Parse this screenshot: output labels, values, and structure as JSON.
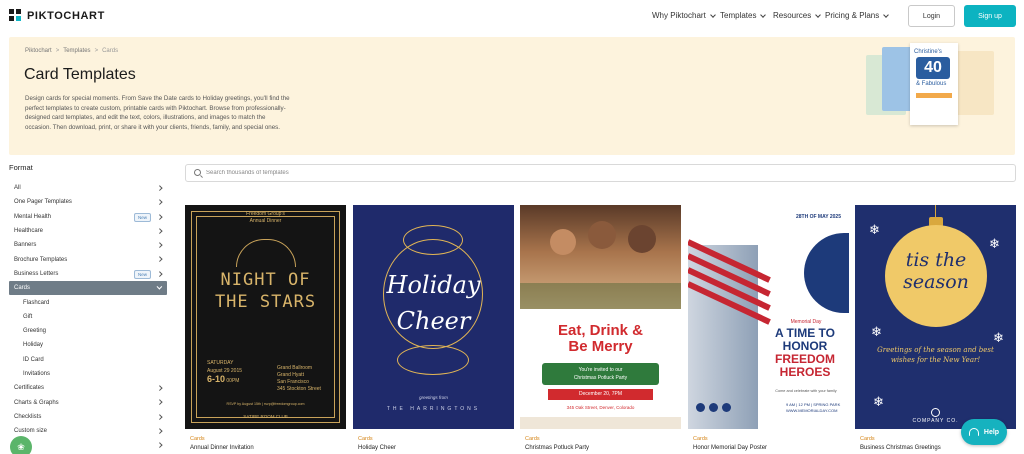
{
  "header": {
    "logo": "PIKTOCHART",
    "nav": [
      "Why Piktochart",
      "Templates",
      "Resources",
      "Pricing & Plans"
    ],
    "login": "Login",
    "signup": "Sign up"
  },
  "hero": {
    "breadcrumb": [
      "Piktochart",
      "Templates",
      "Cards"
    ],
    "title": "Card Templates",
    "description": "Design cards for special moments. From Save the Date cards to Holiday greetings, you'll find the perfect templates to create custom, printable cards with Piktochart. Browse from professionally-designed card templates, and edit the text, colors, illustrations, and images to match the occasion. Then download, print, or share it with your clients, friends, family, and special ones.",
    "art": {
      "line1": "Christine's",
      "number": "40",
      "line2": "& Fabulous"
    }
  },
  "sidebar": {
    "label": "Format",
    "items": [
      {
        "label": "All",
        "chevron": true
      },
      {
        "label": "One Pager Templates",
        "chevron": true
      },
      {
        "label": "Mental Health",
        "chevron": true,
        "badge": "New"
      },
      {
        "label": "Healthcare",
        "chevron": true
      },
      {
        "label": "Banners",
        "chevron": true
      },
      {
        "label": "Brochure Templates",
        "chevron": true
      },
      {
        "label": "Business Letters",
        "chevron": true,
        "badge": "New"
      },
      {
        "label": "Cards",
        "chevron": true,
        "active": true
      },
      {
        "label": "Flashcard",
        "sub": true
      },
      {
        "label": "Gift",
        "sub": true
      },
      {
        "label": "Greeting",
        "sub": true
      },
      {
        "label": "Holiday",
        "sub": true
      },
      {
        "label": "ID Card",
        "sub": true
      },
      {
        "label": "Invitations",
        "sub": true
      },
      {
        "label": "Certificates",
        "chevron": true
      },
      {
        "label": "Charts & Graphs",
        "chevron": true
      },
      {
        "label": "Checklists",
        "chevron": true
      },
      {
        "label": "Custom size",
        "chevron": true
      },
      {
        "label": "...ms",
        "chevron": true
      }
    ]
  },
  "search": {
    "placeholder": "Search thousands of templates"
  },
  "cards": [
    {
      "category": "Cards",
      "title": "Annual Dinner Invitation",
      "art": {
        "head1": "Freedom Group's",
        "head2": "Annual Dinner",
        "main1": "NIGHT OF",
        "main2": "THE STARS",
        "day": "SATURDAY",
        "date": "August 29 2015",
        "time": "6-10",
        "pm": "00PM",
        "venue": "Grand Ballroom\nGrand Hyatt\nSan Francisco\n345 Stockton Street",
        "rsvp": "RSVP by August 15th | rsvp@freedomgroup.com",
        "foot": "SATIRE ROOM CLUB"
      }
    },
    {
      "category": "Cards",
      "title": "Holiday Cheer",
      "art": {
        "line1": "Holiday",
        "line2": "Cheer",
        "greet": "greetings from",
        "sig": "THE HARRINGTONS"
      }
    },
    {
      "category": "Cards",
      "title": "Christmas Potluck Party",
      "art": {
        "h1": "Eat, Drink &",
        "h2": "Be Merry",
        "invite": "You're invited to our\nChristmas Potluck Party",
        "date": "December 20, 7PM",
        "addr": "345 Oak Street, Denver, Colorado"
      }
    },
    {
      "category": "Cards",
      "title": "Honor Memorial Day Poster",
      "art": {
        "date": "28TH OF MAY 2025",
        "sub": "Memorial Day",
        "l1": "A TIME TO",
        "l2": "HONOR",
        "l3": "FREEDOM",
        "l4": "HEROES",
        "tiny": "Come and celebrate with your family",
        "info": "9 AM | 12 PM | SPRING PARK\nWWW.MEMORIALDAY.COM"
      }
    },
    {
      "category": "Cards",
      "title": "Business Christmas Greetings",
      "art": {
        "l1": "tis the",
        "l2": "season",
        "greet": "Greetings of the season and best wishes for the New Year!",
        "company": "COMPANY CO."
      }
    }
  ],
  "help": {
    "label": "Help"
  }
}
